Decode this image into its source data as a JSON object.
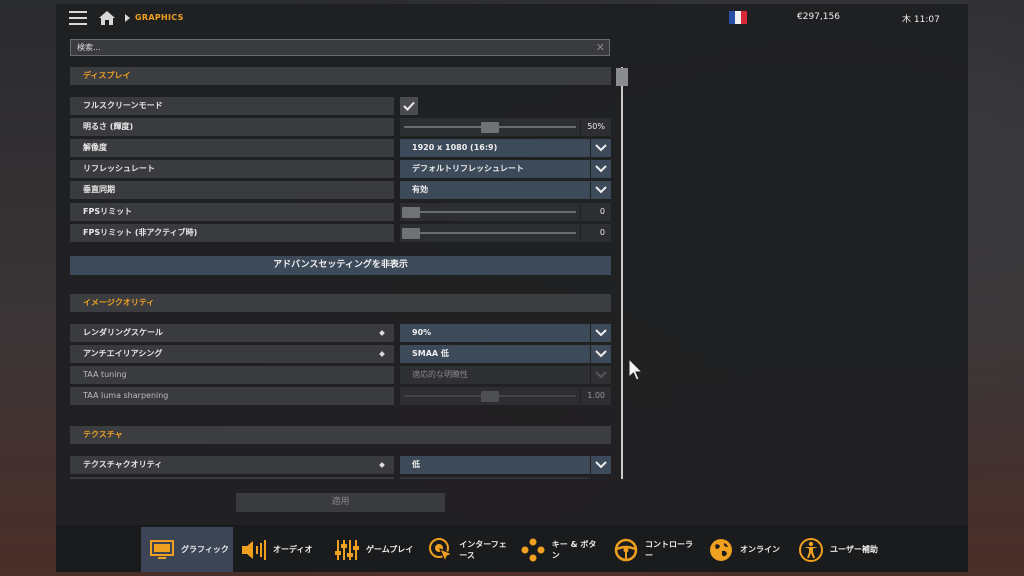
{
  "header": {
    "breadcrumb": "GRAPHICS",
    "money": "€297,156",
    "time": "木 11:07"
  },
  "search": {
    "placeholder": "検索..."
  },
  "sections": {
    "display": "ディスプレイ",
    "image_quality": "イメージクオリティ",
    "texture": "テクスチャ"
  },
  "display": {
    "fullscreen": {
      "label": "フルスクリーンモード",
      "checked": true
    },
    "brightness": {
      "label": "明るさ (輝度)",
      "value": "50%",
      "level": 0.5
    },
    "resolution": {
      "label": "解像度",
      "value": "1920 x 1080 (16:9)"
    },
    "refresh": {
      "label": "リフレッシュレート",
      "value": "デフォルトリフレッシュレート"
    },
    "vsync": {
      "label": "垂直同期",
      "value": "有効"
    },
    "fps_limit": {
      "label": "FPSリミット",
      "value": "0",
      "level": 0
    },
    "fps_limit_inactive": {
      "label": "FPSリミット (非アクティブ時)",
      "value": "0",
      "level": 0
    }
  },
  "advanced_button": "アドバンスセッティングを非表示",
  "image_quality": {
    "render_scale": {
      "label": "レンダリングスケール",
      "value": "90%"
    },
    "antialiasing": {
      "label": "アンチエイリアシング",
      "value": "SMAA 低"
    },
    "taa_tuning": {
      "label": "TAA tuning",
      "value": "適応的な明瞭性"
    },
    "taa_sharpening": {
      "label": "TAA luma sharpening",
      "value": "1.00",
      "level": 0.5
    }
  },
  "texture": {
    "texture_quality": {
      "label": "テクスチャクオリティ",
      "value": "低"
    }
  },
  "apply_button": "適用",
  "tabs": [
    {
      "label": "グラフィック",
      "icon": "monitor-icon",
      "active": true
    },
    {
      "label": "オーディオ",
      "icon": "speaker-icon",
      "active": false
    },
    {
      "label": "ゲームプレイ",
      "icon": "sliders-icon",
      "active": false
    },
    {
      "label": "インターフェース",
      "icon": "cursor-click-icon",
      "active": false
    },
    {
      "label": "キー & ボタン",
      "icon": "gamepad-buttons-icon",
      "active": false
    },
    {
      "label": "コントローラー",
      "icon": "steering-wheel-icon",
      "active": false
    },
    {
      "label": "オンライン",
      "icon": "globe-icon",
      "active": false
    },
    {
      "label": "ユーザー補助",
      "icon": "accessibility-icon",
      "active": false
    }
  ],
  "colors": {
    "accent": "#f0a020",
    "dropdown": "#3d4a5a",
    "active_tab": "#3b4555"
  }
}
